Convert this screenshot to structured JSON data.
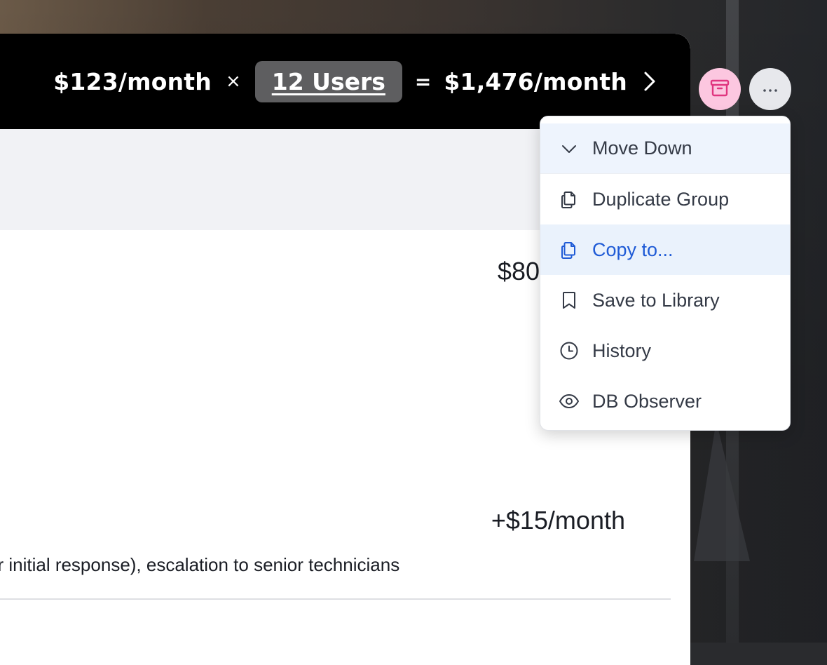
{
  "summary": {
    "unit_price": "$123/month",
    "times": "×",
    "users": "12 Users",
    "equals": "=",
    "total": "$1,476/month"
  },
  "content": {
    "base_price_partial": "$80",
    "addon_price": "+$15/month",
    "addon_description_partial": "ur initial response), escalation to senior technicians"
  },
  "actions": {
    "archive_icon": "archive-icon",
    "more_icon": "more-horizontal-icon",
    "more_glyph": "···"
  },
  "menu": {
    "items": [
      {
        "label": "Move Down",
        "icon": "chevron-down-icon"
      },
      {
        "label": "Duplicate Group",
        "icon": "copy-icon"
      },
      {
        "label": "Copy to...",
        "icon": "copy-icon"
      },
      {
        "label": "Save to Library",
        "icon": "bookmark-icon"
      },
      {
        "label": "History",
        "icon": "clock-icon"
      },
      {
        "label": "DB Observer",
        "icon": "eye-icon"
      }
    ]
  },
  "colors": {
    "accent_blue": "#1f5bd6",
    "archive_bg": "#fcc7e0",
    "archive_icon": "#e0357f",
    "bar_bg": "#000000"
  }
}
